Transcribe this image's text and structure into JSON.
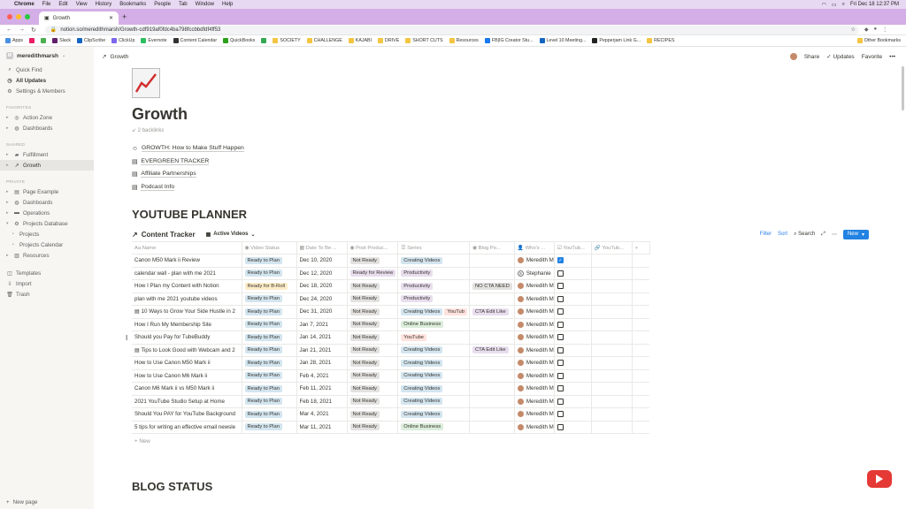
{
  "menubar": {
    "app": "Chrome",
    "items": [
      "File",
      "Edit",
      "View",
      "History",
      "Bookmarks",
      "People",
      "Tab",
      "Window",
      "Help"
    ],
    "clock": "Fri Dec 18  12:37 PM"
  },
  "browser": {
    "tab_title": "Growth",
    "url": "notion.so/meredithmarsh/Growth-cdf919af0fdc4ba798fccbbdfdf4ff53",
    "bookmarks": [
      "Apps",
      "Slack",
      "ClipScribe",
      "ClickUp",
      "Evernote",
      "Content Calendar",
      "QuickBooks",
      "SOCIETY",
      "CHALLENGE",
      "KAJABI",
      "DRIVE",
      "SHORT CUTS",
      "Resources",
      "FB|IG Creator Stu...",
      "Level 10 Meeting...",
      "Pepperjam Link G...",
      "RECIPES"
    ],
    "other_bookmarks": "Other Bookmarks"
  },
  "sidebar": {
    "workspace": "meredithmarsh",
    "top_items": [
      "Quick Find",
      "All Updates",
      "Settings & Members"
    ],
    "favorites_label": "FAVORITES",
    "favorites": [
      "Action Zone",
      "Dashboards"
    ],
    "shared_label": "SHARED",
    "shared": [
      "Fulfillment",
      "Growth"
    ],
    "private_label": "PRIVATE",
    "private": [
      "Page Example",
      "Dashboards",
      "Operations",
      "Projects Database",
      "Projects",
      "Projects Calendar",
      "Resources"
    ],
    "bottom_items": [
      "Templates",
      "Import",
      "Trash"
    ],
    "new_page": "New page"
  },
  "topbar": {
    "breadcrumb": "Growth",
    "share": "Share",
    "updates": "Updates",
    "favorite": "Favorite",
    "more": "•••"
  },
  "page": {
    "title": "Growth",
    "backlinks": "2 backlinks",
    "links": [
      "GROWTH: How to Make Stuff Happen",
      "EVERGREEN TRACKER",
      "Affiliate Partnerships",
      "Podcast Info"
    ],
    "section1": "YOUTUBE PLANNER",
    "db_title": "Content Tracker",
    "db_view": "Active Videos",
    "tools": {
      "filter": "Filter",
      "sort": "Sort",
      "search": "Search",
      "new": "New"
    },
    "columns": [
      "Name",
      "Video Status",
      "Date To Be ...",
      "Post Produc...",
      "Series",
      "Blog Po...",
      "Who's ...",
      "YouTub...",
      "YouTub..."
    ],
    "rows": [
      {
        "name": "Canon M50 Mark ii Review",
        "status": "Ready to Plan",
        "date": "Dec 10, 2020",
        "post": "Not Ready",
        "series": [
          "Creating Videos"
        ],
        "blog": "",
        "who": "Meredith M",
        "checked": true
      },
      {
        "name": "calendar wall - plan with me 2021",
        "status": "Ready to Plan",
        "date": "Dec 12, 2020",
        "post": "Ready for Review",
        "series": [
          "Productivity"
        ],
        "blog": "",
        "who": "Stephanie",
        "checked": false
      },
      {
        "name": "How I Plan my Content with Notion",
        "status": "Ready for B-Roll",
        "date": "Dec 18, 2020",
        "post": "Not Ready",
        "series": [
          "Productivity"
        ],
        "blog": "NO CTA NEED",
        "who": "Meredith M",
        "checked": false
      },
      {
        "name": "plan with me 2021 youtube videos",
        "status": "Ready to Plan",
        "date": "Dec 24, 2020",
        "post": "Not Ready",
        "series": [
          "Productivity"
        ],
        "blog": "",
        "who": "Meredith M",
        "checked": false
      },
      {
        "name": "10 Ways to Grow Your Side Hustle in 2",
        "status": "Ready to Plan",
        "date": "Dec 31, 2020",
        "post": "Not Ready",
        "series": [
          "Creating Videos",
          "YouTub"
        ],
        "blog": "CTA Edit Like",
        "who": "Meredith M",
        "checked": false
      },
      {
        "name": "How I Run My Membership Site",
        "status": "Ready to Plan",
        "date": "Jan 7, 2021",
        "post": "Not Ready",
        "series": [
          "Online Business"
        ],
        "blog": "",
        "who": "Meredith M",
        "checked": false
      },
      {
        "name": "Should you Pay for TubeBuddy",
        "status": "Ready to Plan",
        "date": "Jan 14, 2021",
        "post": "Not Ready",
        "series": [
          "YouTube"
        ],
        "blog": "",
        "who": "Meredith M",
        "checked": false
      },
      {
        "name": "Tips to Look Good with Webcam and 2",
        "status": "Ready to Plan",
        "date": "Jan 21, 2021",
        "post": "Not Ready",
        "series": [
          "Creating Videos"
        ],
        "blog": "CTA Edit Like",
        "who": "Meredith M",
        "checked": false
      },
      {
        "name": "How to Use Canon M50 Mark ii",
        "status": "Ready to Plan",
        "date": "Jan 28, 2021",
        "post": "Not Ready",
        "series": [
          "Creating Videos"
        ],
        "blog": "",
        "who": "Meredith M",
        "checked": false
      },
      {
        "name": "How to Use Canon M6 Mark ii",
        "status": "Ready to Plan",
        "date": "Feb 4, 2021",
        "post": "Not Ready",
        "series": [
          "Creating Videos"
        ],
        "blog": "",
        "who": "Meredith M",
        "checked": false
      },
      {
        "name": "Canon M6 Mark ii vs M50 Mark ii",
        "status": "Ready to Plan",
        "date": "Feb 11, 2021",
        "post": "Not Ready",
        "series": [
          "Creating Videos"
        ],
        "blog": "",
        "who": "Meredith M",
        "checked": false
      },
      {
        "name": "2021 YouTube Studio Setup at Home",
        "status": "Ready to Plan",
        "date": "Feb 18, 2021",
        "post": "Not Ready",
        "series": [
          "Creating Videos"
        ],
        "blog": "",
        "who": "Meredith M",
        "checked": false
      },
      {
        "name": "Should You PAY for YouTube Background",
        "status": "Ready to Plan",
        "date": "Mar 4, 2021",
        "post": "Not Ready",
        "series": [
          "Creating Videos"
        ],
        "blog": "",
        "who": "Meredith M",
        "checked": false
      },
      {
        "name": "5 tips for writing an effective email newsle",
        "status": "Ready to Plan",
        "date": "Mar 11, 2021",
        "post": "Not Ready",
        "series": [
          "Online Business"
        ],
        "blog": "",
        "who": "Meredith M",
        "checked": false
      }
    ],
    "new_row": "New",
    "section2": "BLOG STATUS"
  },
  "tag_colors": {
    "Ready to Plan": "#d3e5ef",
    "Ready for B-Roll": "#fdecc8",
    "Not Ready": "#e3e2e0",
    "Ready for Review": "#e8deee",
    "Creating Videos": "#d3e5ef",
    "Productivity": "#e8deee",
    "Online Business": "#dbeddb",
    "YouTube": "#ffe2dd",
    "YouTub": "#ffe2dd",
    "NO CTA NEED": "#e3e2e0",
    "CTA Edit Like": "#e8deee"
  }
}
